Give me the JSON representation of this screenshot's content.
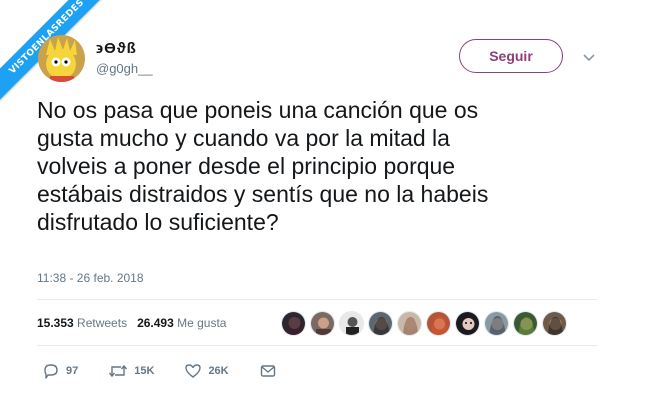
{
  "watermark": {
    "text": "VISTOENLASREDES"
  },
  "user": {
    "display_name": "϶ϴϑß",
    "handle": "@g0gh__"
  },
  "follow": {
    "label": "Seguir"
  },
  "tweet": {
    "lines": [
      "No os pasa que poneis una canción que os",
      "gusta mucho y cuando va por la mitad la",
      "volveis a poner desde el principio porque",
      "estábais distraidos y sentís que no la habeis",
      "disfrutado lo suficiente?"
    ],
    "timestamp": "11:38 - 26 feb. 2018"
  },
  "stats": {
    "retweets_count": "15.353",
    "retweets_label": "Retweets",
    "likes_count": "26.493",
    "likes_label": "Me gusta"
  },
  "actions": {
    "replies": "97",
    "retweets": "15K",
    "likes": "26K"
  },
  "colors": {
    "follow_accent": "#8c3f7a",
    "watermark": "#1da1f2",
    "muted": "#657786"
  },
  "liker_avatars": 10
}
